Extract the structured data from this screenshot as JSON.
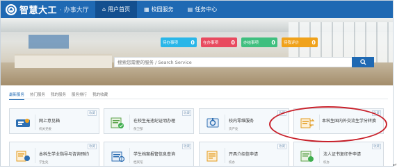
{
  "header": {
    "logo_name": "智慧大工",
    "logo_sub": "· 办事大厅",
    "nav": [
      {
        "label": "用户首页",
        "icon": "home-icon",
        "active": true
      },
      {
        "label": "校园服务",
        "icon": "grid-icon",
        "active": false
      },
      {
        "label": "任务中心",
        "icon": "task-icon",
        "active": false
      }
    ]
  },
  "stats": [
    {
      "label": "待办事项",
      "value": "0",
      "color": "#29b6e8"
    },
    {
      "label": "在办事项",
      "value": "0",
      "color": "#e84a5f"
    },
    {
      "label": "办结事项",
      "value": "0",
      "color": "#3fbf7f"
    },
    {
      "label": "待我评价",
      "value": "0",
      "color": "#f0a21b"
    }
  ],
  "search": {
    "placeholder": "搜索您需要的服务 / Search Service"
  },
  "tabs": [
    "最新服务",
    "热门服务",
    "我的服务",
    "服务排行",
    "我的收藏"
  ],
  "cards": [
    {
      "title": "网上意见箱",
      "sub": "机关党委",
      "icon": "mailbox-icon",
      "fav": "收藏"
    },
    {
      "title": "在校生无违纪证明办理",
      "sub": "保卫部",
      "icon": "certificate-icon",
      "fav": "收藏"
    },
    {
      "title": "校内零维服务",
      "sub": "资产处",
      "icon": "maintenance-icon",
      "fav": "收藏"
    },
    {
      "title": "本科生国内外交流生学分转换",
      "sub": "",
      "icon": "credit-transfer-icon",
      "fav": "收藏"
    },
    {
      "title": "本科生学业指导与咨询预约",
      "sub": "学生处",
      "icon": "consult-icon",
      "fav": "收藏"
    },
    {
      "title": "学生档案报管信息查询",
      "sub": "档案馆",
      "icon": "archive-icon",
      "fav": "收藏"
    },
    {
      "title": "开具介绍信申请",
      "sub": "校办",
      "icon": "letter-icon",
      "fav": "收藏"
    },
    {
      "title": "法人证书复印件申请",
      "sub": "校办",
      "icon": "license-icon",
      "fav": "收藏"
    }
  ],
  "colors": {
    "brand": "#1f69b3",
    "annotation": "#c8202a"
  },
  "corner_mark": "↵"
}
